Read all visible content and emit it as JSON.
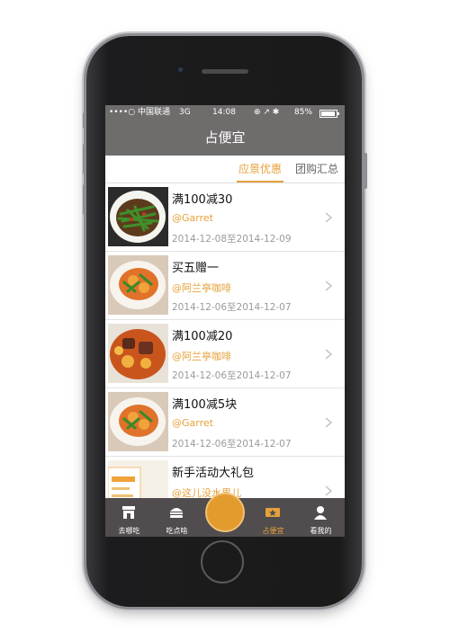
{
  "status_bar": {
    "carrier": "••••○ 中国联通",
    "network": "3G",
    "time": "14:08",
    "battery": "85%"
  },
  "nav": {
    "title": "占便宜"
  },
  "tabs": [
    {
      "label": "应景优惠",
      "active": true
    },
    {
      "label": "团购汇总",
      "active": false
    }
  ],
  "deals": [
    {
      "title": "满100减30",
      "shop": "@Garret",
      "date": "2014-12-08至2014-12-09",
      "image": "green-beans-dish"
    },
    {
      "title": "买五赠一",
      "shop": "@阿兰亭咖啡",
      "date": "2014-12-06至2014-12-07",
      "image": "potato-dish"
    },
    {
      "title": "满100减20",
      "shop": "@阿兰亭咖啡",
      "date": "2014-12-06至2014-12-07",
      "image": "beef-stew"
    },
    {
      "title": "满100减5块",
      "shop": "@Garret",
      "date": "2014-12-06至2014-12-07",
      "image": "potato-dish"
    },
    {
      "title": "新手活动大礼包",
      "shop": "@这儿没水果儿",
      "date": "",
      "image": "promo-card"
    }
  ],
  "tabbar": [
    {
      "label": "去哪吃",
      "icon": "store-icon",
      "active": false
    },
    {
      "label": "吃点啥",
      "icon": "burger-icon",
      "active": false
    },
    {
      "label": "",
      "icon": "center-action-button",
      "active": false
    },
    {
      "label": "占便宜",
      "icon": "ticket-star-icon",
      "active": true
    },
    {
      "label": "看我的",
      "icon": "person-icon",
      "active": false
    }
  ],
  "colors": {
    "accent": "#e6a13a",
    "navbar": "#6f6c6c",
    "tabbar": "#514d4e"
  }
}
